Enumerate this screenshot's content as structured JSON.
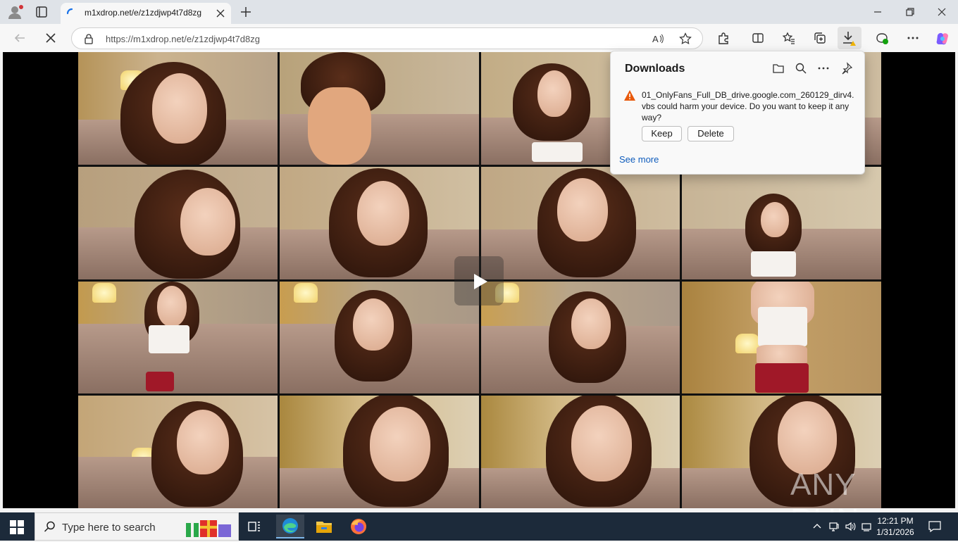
{
  "browser": {
    "tab": {
      "title": "m1xdrop.net/e/z1zdjwp4t7d8zg"
    },
    "address": {
      "url": "https://m1xdrop.net/e/z1zdjwp4t7d8zg"
    }
  },
  "downloads": {
    "title": "Downloads",
    "warning_text": "01_OnlyFans_Full_DB_drive.google.com_260129_dirv4.vbs could harm your device. Do you want to keep it anyway?",
    "keep_label": "Keep",
    "delete_label": "Delete",
    "see_more_label": "See more"
  },
  "video": {
    "watermark": "ANY RUN"
  },
  "taskbar": {
    "search_placeholder": "Type here to search",
    "time": "12:21 PM",
    "date": "1/31/2026"
  },
  "colors": {
    "taskbar": "#1c2a3a",
    "link": "#0f5cbc",
    "warning": "#e8590c"
  }
}
